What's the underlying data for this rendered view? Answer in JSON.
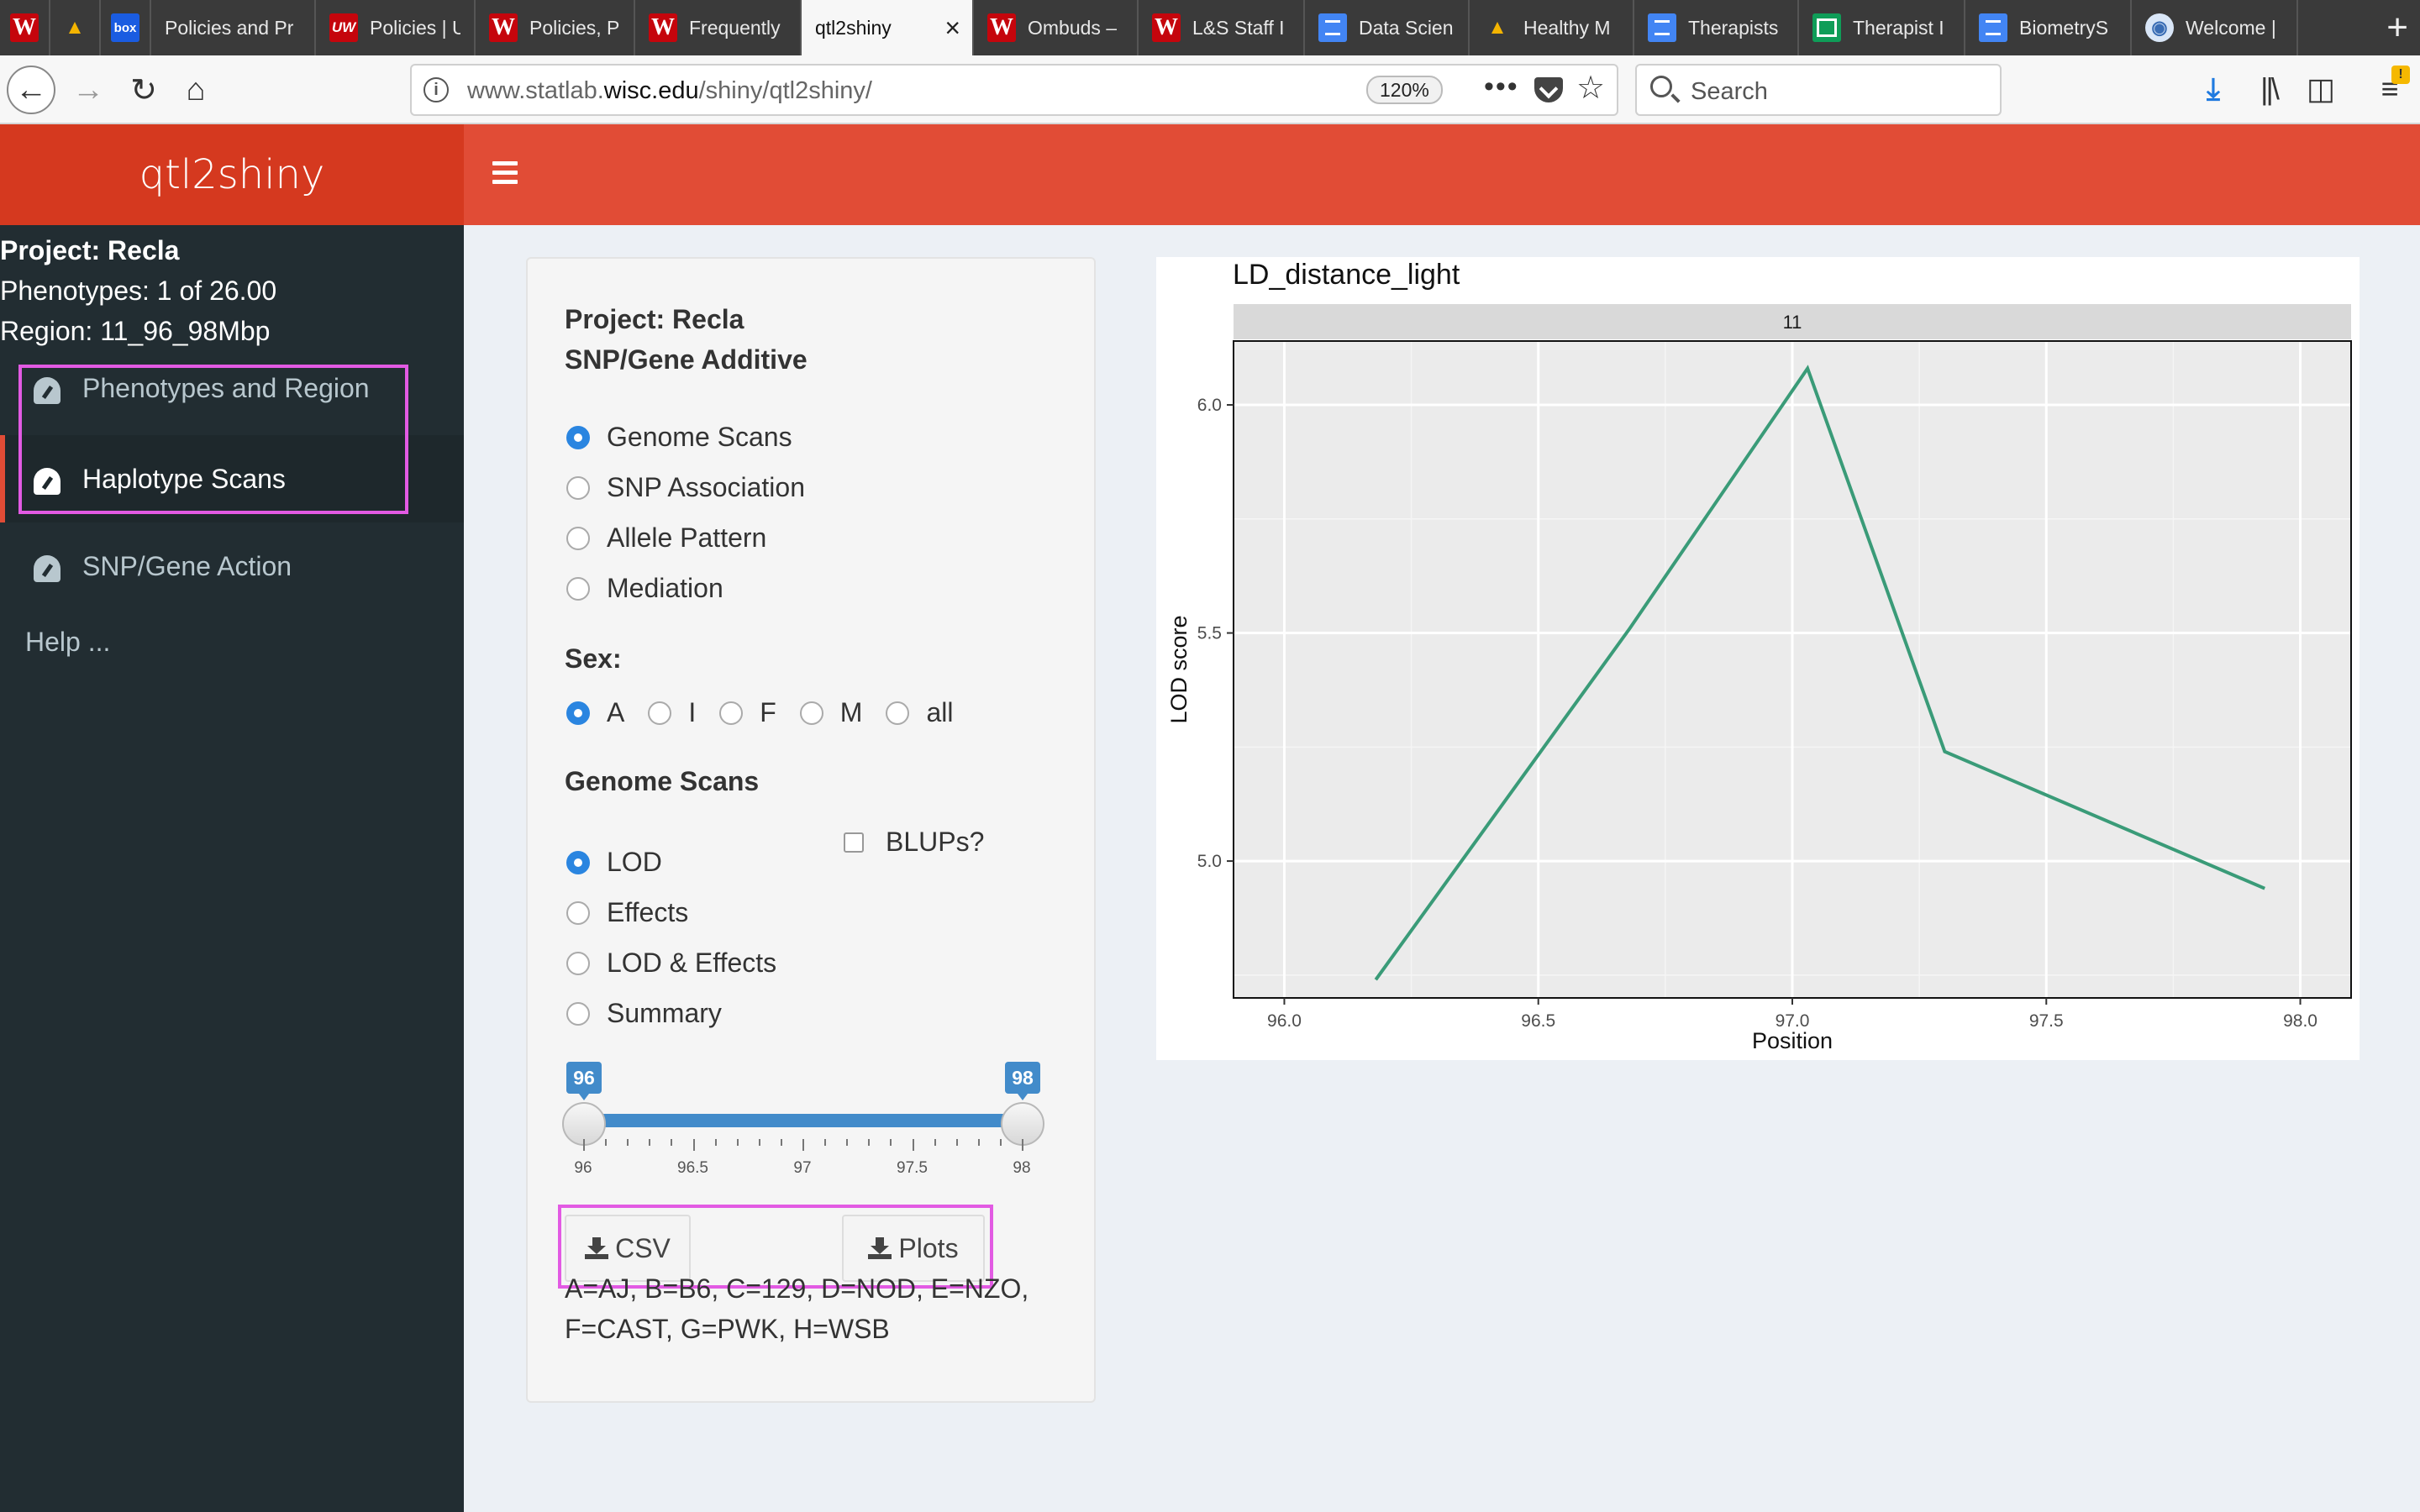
{
  "browser": {
    "tabs": [
      {
        "label": "",
        "icon": "w-icon"
      },
      {
        "label": "",
        "icon": "drive-icon"
      },
      {
        "label": "",
        "icon": "box-icon"
      },
      {
        "label": "Policies and Pr",
        "icon": ""
      },
      {
        "label": "Policies | U",
        "icon": "uw-icon"
      },
      {
        "label": "Policies, P",
        "icon": "w-icon"
      },
      {
        "label": "Frequently",
        "icon": "w-icon"
      },
      {
        "label": "qtl2shiny",
        "icon": "",
        "active": true
      },
      {
        "label": "Ombuds –",
        "icon": "w-icon"
      },
      {
        "label": "L&S Staff I",
        "icon": "w-icon"
      },
      {
        "label": "Data Scien",
        "icon": "doc-icon"
      },
      {
        "label": "Healthy M",
        "icon": "drive-icon"
      },
      {
        "label": "Therapists",
        "icon": "doc-icon"
      },
      {
        "label": "Therapist I",
        "icon": "sheet-icon"
      },
      {
        "label": "BiometryS",
        "icon": "doc-icon"
      },
      {
        "label": "Welcome |",
        "icon": "globe-icon"
      }
    ],
    "url_prefix": "www.statlab.",
    "url_domain": "wisc.edu",
    "url_path": "/shiny/qtl2shiny/",
    "zoom": "120%",
    "search_placeholder": "Search"
  },
  "app": {
    "title": "qtl2shiny",
    "header_color": "#e14c36"
  },
  "sidebar": {
    "project": "Project: Recla",
    "phenotypes": "Phenotypes: 1 of 26.00",
    "region": "Region: 11_96_98Mbp",
    "items": [
      {
        "label": "Phenotypes and Region"
      },
      {
        "label": "Haplotype Scans"
      },
      {
        "label": "SNP/Gene Action"
      }
    ],
    "help": "Help ..."
  },
  "panel": {
    "title_line1": "Project: Recla",
    "title_line2": "SNP/Gene Additive",
    "analysis_options": [
      "Genome Scans",
      "SNP Association",
      "Allele Pattern",
      "Mediation"
    ],
    "analysis_selected": "Genome Scans",
    "sex_label": "Sex:",
    "sex_options": [
      "A",
      "I",
      "F",
      "M",
      "all"
    ],
    "sex_selected": "A",
    "scan_label": "Genome Scans",
    "scan_options": [
      "LOD",
      "Effects",
      "LOD & Effects",
      "Summary"
    ],
    "scan_selected": "LOD",
    "blups_label": "BLUPs?",
    "blups_checked": false,
    "slider": {
      "min": 96,
      "max": 98,
      "low": "96",
      "high": "98",
      "tick_labels": [
        "96",
        "96.5",
        "97",
        "97.5",
        "98"
      ]
    },
    "csv_button": "CSV",
    "plots_button": "Plots",
    "legend_line1": "A=AJ, B=B6, C=129, D=NOD, E=NZO,",
    "legend_line2": "F=CAST, G=PWK, H=WSB"
  },
  "chart_data": {
    "type": "line",
    "title": "LD_distance_light",
    "facet_label": "11",
    "xlabel": "Position",
    "ylabel": "LOD score",
    "xlim": [
      95.9,
      98.1
    ],
    "ylim": [
      4.7,
      6.14
    ],
    "xticks": [
      "96.0",
      "96.5",
      "97.0",
      "97.5",
      "98.0"
    ],
    "yticks": [
      "5.0",
      "5.5",
      "6.0"
    ],
    "series": [
      {
        "color": "#3a9b78",
        "x": [
          96.18,
          96.68,
          97.03,
          97.3,
          97.93
        ],
        "y": [
          4.74,
          5.51,
          6.08,
          5.24,
          4.94
        ]
      }
    ],
    "grid": true
  }
}
